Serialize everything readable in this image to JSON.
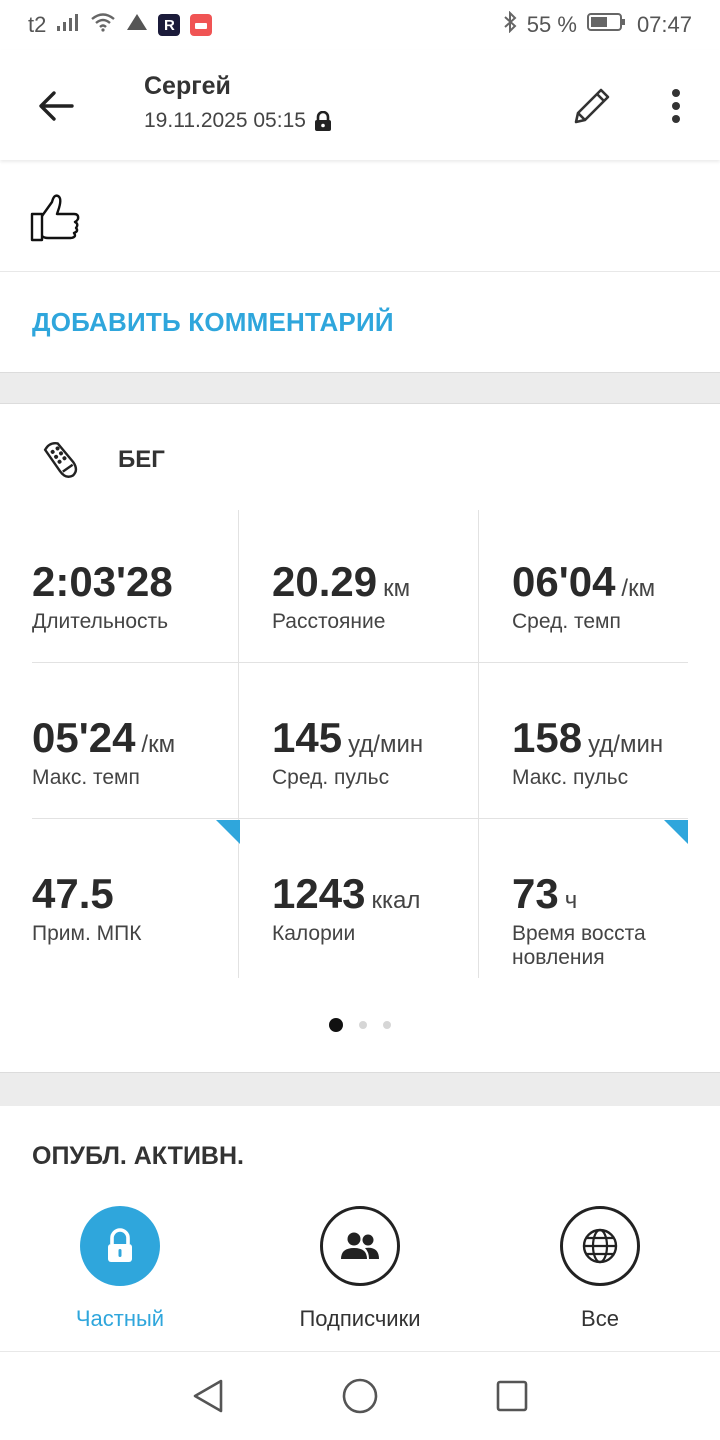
{
  "status_bar": {
    "carrier": "t2",
    "battery": "55 %",
    "time": "07:47",
    "badge_r": "R"
  },
  "header": {
    "user_name": "Сергей",
    "date": "19.11.2025 05:15"
  },
  "comment": {
    "add_label": "ДОБАВИТЬ КОММЕНТАРИЙ"
  },
  "activity": {
    "title": "БЕГ",
    "stats": [
      {
        "value": "2:03'28",
        "unit": "",
        "label": "Длительность"
      },
      {
        "value": "20.29",
        "unit": "км",
        "label": "Расстояние"
      },
      {
        "value": "06'04",
        "unit": "/км",
        "label": "Сред. темп"
      },
      {
        "value": "05'24",
        "unit": "/км",
        "label": "Макс. темп"
      },
      {
        "value": "145",
        "unit": "уд/мин",
        "label": "Сред. пульс"
      },
      {
        "value": "158",
        "unit": "уд/мин",
        "label": "Макс. пульс"
      },
      {
        "value": "47.5",
        "unit": "",
        "label": "Прим. МПК"
      },
      {
        "value": "1243",
        "unit": "ккал",
        "label": "Калории"
      },
      {
        "value": "73",
        "unit": "ч",
        "label": "Время восста новления"
      }
    ],
    "pager": {
      "pages": 3,
      "active": 1
    }
  },
  "publish": {
    "title": "ОПУБЛ. АКТИВН.",
    "options": [
      {
        "label": "Частный",
        "icon": "lock-icon",
        "selected": true
      },
      {
        "label": "Подписчики",
        "icon": "followers-icon",
        "selected": false
      },
      {
        "label": "Все",
        "icon": "globe-icon",
        "selected": false
      }
    ]
  },
  "colors": {
    "accent": "#2fa6dc",
    "text": "#333333",
    "divider": "#e2e2e2",
    "gap": "#ececec"
  }
}
